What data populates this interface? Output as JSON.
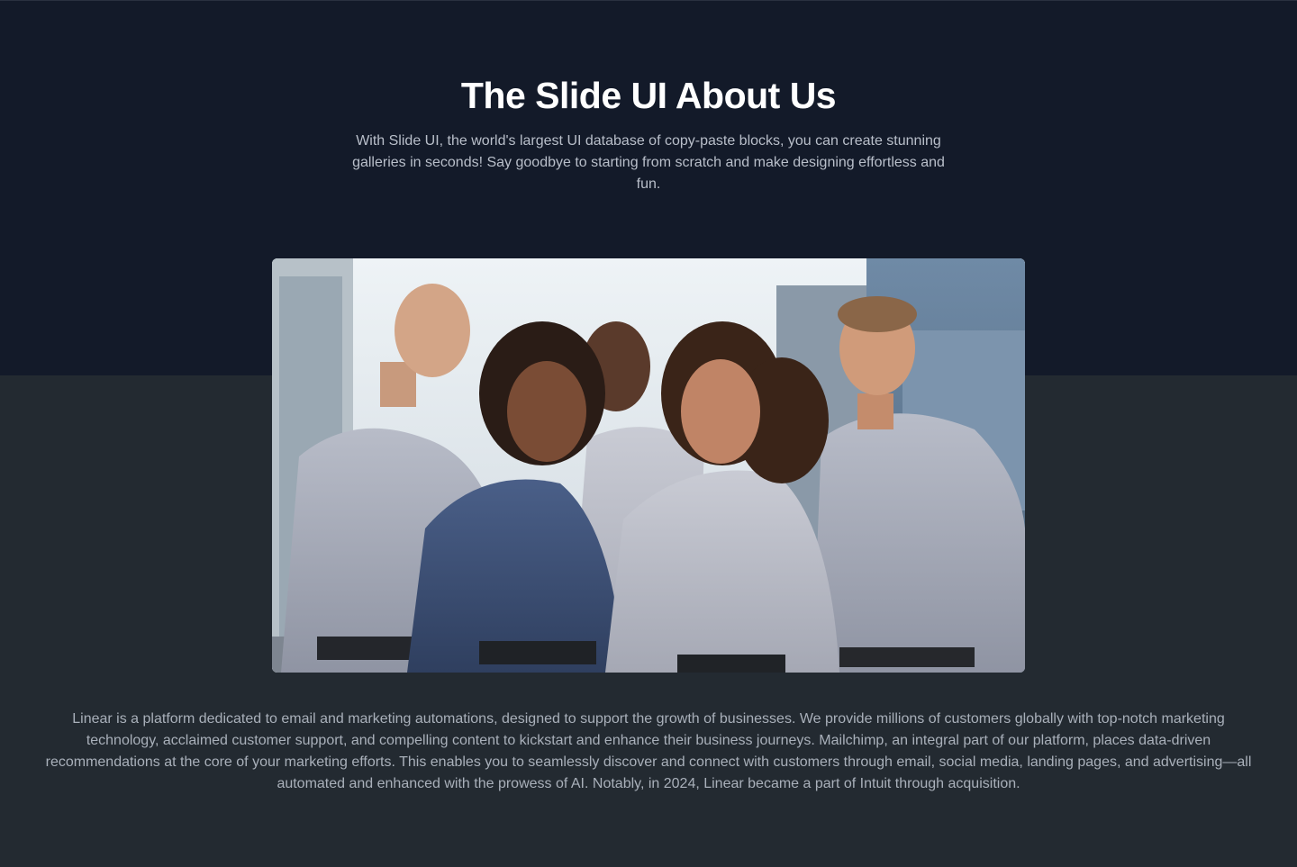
{
  "hero": {
    "title": "The Slide UI About Us",
    "subtitle": "With Slide UI, the world's largest UI database of copy-paste blocks, you can create stunning galleries in seconds! Say goodbye to starting from scratch and make designing effortless and fun."
  },
  "team_photo": {
    "icon": "team-photo"
  },
  "about": {
    "body": "Linear is a platform dedicated to email and marketing automations, designed to support the growth of businesses. We provide millions of customers globally with top-notch marketing technology, acclaimed customer support, and compelling content to kickstart and enhance their business journeys. Mailchimp, an integral part of our platform, places data-driven recommendations at the core of your marketing efforts. This enables you to seamlessly discover and connect with customers through email, social media, landing pages, and advertising—all automated and enhanced with the prowess of AI. Notably, in 2024, Linear became a part of Intuit through acquisition."
  },
  "colors": {
    "hero_background": "#131a29",
    "page_background": "#232a31",
    "title": "#ffffff",
    "subtitle": "#b9bfca",
    "body": "#a9b0ba"
  }
}
